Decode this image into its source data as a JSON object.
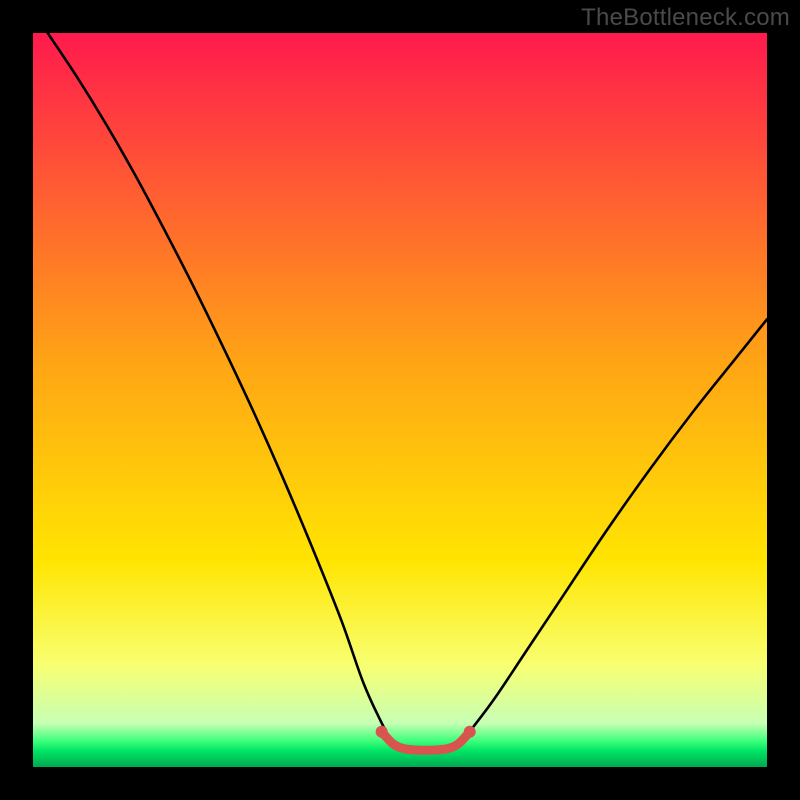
{
  "watermark": "TheBottleneck.com",
  "chart_data": {
    "type": "line",
    "title": "",
    "xlabel": "",
    "ylabel": "",
    "xlim": [
      0,
      100
    ],
    "ylim": [
      0,
      100
    ],
    "background_gradient": {
      "stops": [
        {
          "offset": 0.0,
          "color": "#ff1a4d"
        },
        {
          "offset": 0.45,
          "color": "#ffa515"
        },
        {
          "offset": 0.72,
          "color": "#ffe502"
        },
        {
          "offset": 0.86,
          "color": "#f8ff70"
        },
        {
          "offset": 0.94,
          "color": "#c8ffb4"
        },
        {
          "offset": 0.965,
          "color": "#3bff7a"
        },
        {
          "offset": 0.978,
          "color": "#00e565"
        },
        {
          "offset": 1.0,
          "color": "#00a850"
        }
      ]
    },
    "series": [
      {
        "name": "left-curve",
        "x": [
          2,
          6,
          10,
          14,
          18,
          22,
          26,
          30,
          34,
          38,
          42,
          45,
          47.5,
          49
        ],
        "y": [
          100,
          94,
          87.5,
          80.5,
          73,
          65.2,
          57,
          48.5,
          39.5,
          30,
          20,
          11.5,
          6,
          3.2
        ]
      },
      {
        "name": "right-curve",
        "x": [
          58,
          60,
          63,
          67,
          72,
          78,
          84,
          90,
          96,
          100
        ],
        "y": [
          3.2,
          5.5,
          9.5,
          15.5,
          23,
          32,
          40.5,
          48.5,
          56,
          61
        ]
      },
      {
        "name": "valley-highlight",
        "color": "#d9534f",
        "x": [
          47.5,
          49,
          50.5,
          52.5,
          54.5,
          56.5,
          58,
          59.5
        ],
        "y": [
          4.8,
          3.2,
          2.5,
          2.3,
          2.3,
          2.5,
          3.2,
          4.8
        ]
      }
    ]
  }
}
